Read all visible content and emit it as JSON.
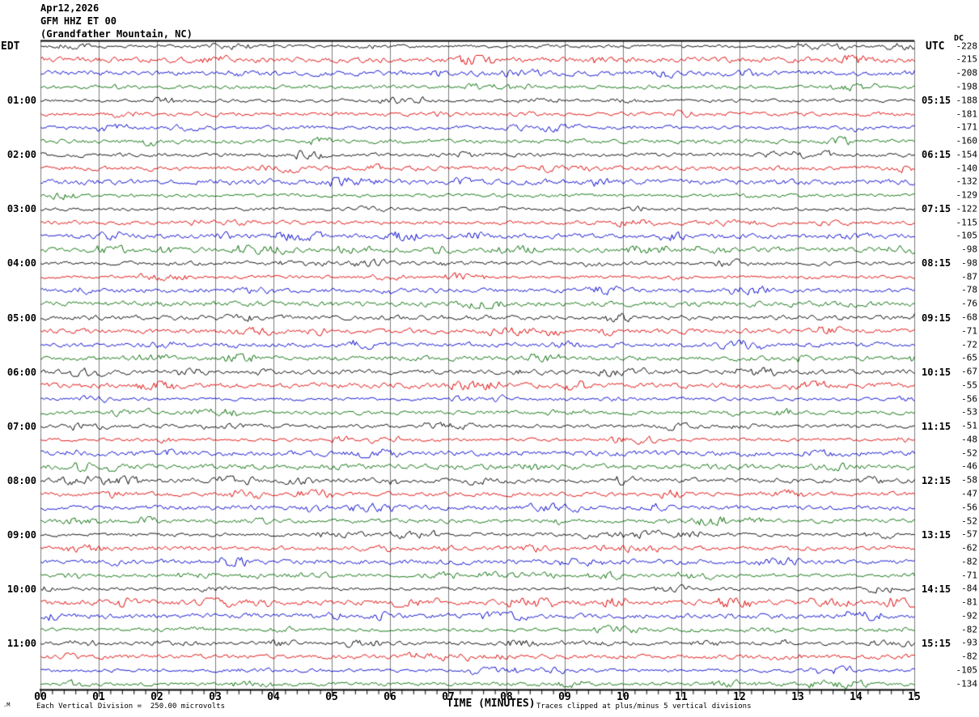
{
  "header": {
    "date": "Apr12,2026",
    "station": "GFM HHZ ET 00",
    "location": "(Grandfather Mountain, NC)"
  },
  "axes": {
    "left_label": "EDT",
    "right_label": "UTC",
    "dc_label": "DC",
    "x_axis_label": "TIME (MINUTES)",
    "x_ticks": [
      "00",
      "01",
      "02",
      "03",
      "04",
      "05",
      "06",
      "07",
      "08",
      "09",
      "10",
      "11",
      "12",
      "13",
      "14",
      "15"
    ]
  },
  "footer": {
    "left_note": "Each Vertical Division =  250.00 microvolts",
    "right_note": "Traces clipped at plus/minus 5 vertical divisions",
    "corner_mark": ".M"
  },
  "chart_data": {
    "type": "line",
    "subtype": "helicorder-seismogram",
    "title": "GFM HHZ ET 00 (Grandfather Mountain, NC) Apr12,2026",
    "xlabel": "TIME (MINUTES)",
    "x_range_minutes": [
      0,
      15
    ],
    "minutes_per_row": 15,
    "rows_per_hour": 4,
    "left_time_zone": "EDT",
    "right_time_zone": "UTC",
    "scale_note": "Each Vertical Division =  250.00 microvolts",
    "clip_note": "Traces clipped at plus/minus 5 vertical divisions",
    "trace_color_cycle": [
      "#000000",
      "#dd0000",
      "#0000cc",
      "#006c00"
    ],
    "grid_color": "#7d7d7d",
    "rows": [
      {
        "edt": "",
        "utc": "",
        "dc": -228
      },
      {
        "edt": "",
        "utc": "",
        "dc": -215
      },
      {
        "edt": "",
        "utc": "",
        "dc": -208
      },
      {
        "edt": "",
        "utc": "",
        "dc": -198
      },
      {
        "edt": "01:00",
        "utc": "05:15",
        "dc": -188
      },
      {
        "edt": "",
        "utc": "",
        "dc": -181
      },
      {
        "edt": "",
        "utc": "",
        "dc": -171
      },
      {
        "edt": "",
        "utc": "",
        "dc": -160
      },
      {
        "edt": "02:00",
        "utc": "06:15",
        "dc": -154
      },
      {
        "edt": "",
        "utc": "",
        "dc": -140
      },
      {
        "edt": "",
        "utc": "",
        "dc": -132
      },
      {
        "edt": "",
        "utc": "",
        "dc": -129
      },
      {
        "edt": "03:00",
        "utc": "07:15",
        "dc": -122
      },
      {
        "edt": "",
        "utc": "",
        "dc": -115
      },
      {
        "edt": "",
        "utc": "",
        "dc": -105
      },
      {
        "edt": "",
        "utc": "",
        "dc": -98
      },
      {
        "edt": "04:00",
        "utc": "08:15",
        "dc": -98
      },
      {
        "edt": "",
        "utc": "",
        "dc": -87
      },
      {
        "edt": "",
        "utc": "",
        "dc": -78
      },
      {
        "edt": "",
        "utc": "",
        "dc": -76
      },
      {
        "edt": "05:00",
        "utc": "09:15",
        "dc": -68
      },
      {
        "edt": "",
        "utc": "",
        "dc": -71
      },
      {
        "edt": "",
        "utc": "",
        "dc": -72
      },
      {
        "edt": "",
        "utc": "",
        "dc": -65
      },
      {
        "edt": "06:00",
        "utc": "10:15",
        "dc": -67
      },
      {
        "edt": "",
        "utc": "",
        "dc": -55
      },
      {
        "edt": "",
        "utc": "",
        "dc": -56
      },
      {
        "edt": "",
        "utc": "",
        "dc": -53
      },
      {
        "edt": "07:00",
        "utc": "11:15",
        "dc": -51
      },
      {
        "edt": "",
        "utc": "",
        "dc": -48
      },
      {
        "edt": "",
        "utc": "",
        "dc": -52
      },
      {
        "edt": "",
        "utc": "",
        "dc": -46
      },
      {
        "edt": "08:00",
        "utc": "12:15",
        "dc": -58
      },
      {
        "edt": "",
        "utc": "",
        "dc": -47
      },
      {
        "edt": "",
        "utc": "",
        "dc": -56
      },
      {
        "edt": "",
        "utc": "",
        "dc": -52
      },
      {
        "edt": "09:00",
        "utc": "13:15",
        "dc": -57
      },
      {
        "edt": "",
        "utc": "",
        "dc": -62
      },
      {
        "edt": "",
        "utc": "",
        "dc": -82
      },
      {
        "edt": "",
        "utc": "",
        "dc": -71
      },
      {
        "edt": "10:00",
        "utc": "14:15",
        "dc": -84
      },
      {
        "edt": "",
        "utc": "",
        "dc": -81
      },
      {
        "edt": "",
        "utc": "",
        "dc": -92
      },
      {
        "edt": "",
        "utc": "",
        "dc": -82
      },
      {
        "edt": "11:00",
        "utc": "15:15",
        "dc": -93
      },
      {
        "edt": "",
        "utc": "",
        "dc": -82
      },
      {
        "edt": "",
        "utc": "",
        "dc": -105
      },
      {
        "edt": "",
        "utc": "",
        "dc": -134
      }
    ]
  }
}
